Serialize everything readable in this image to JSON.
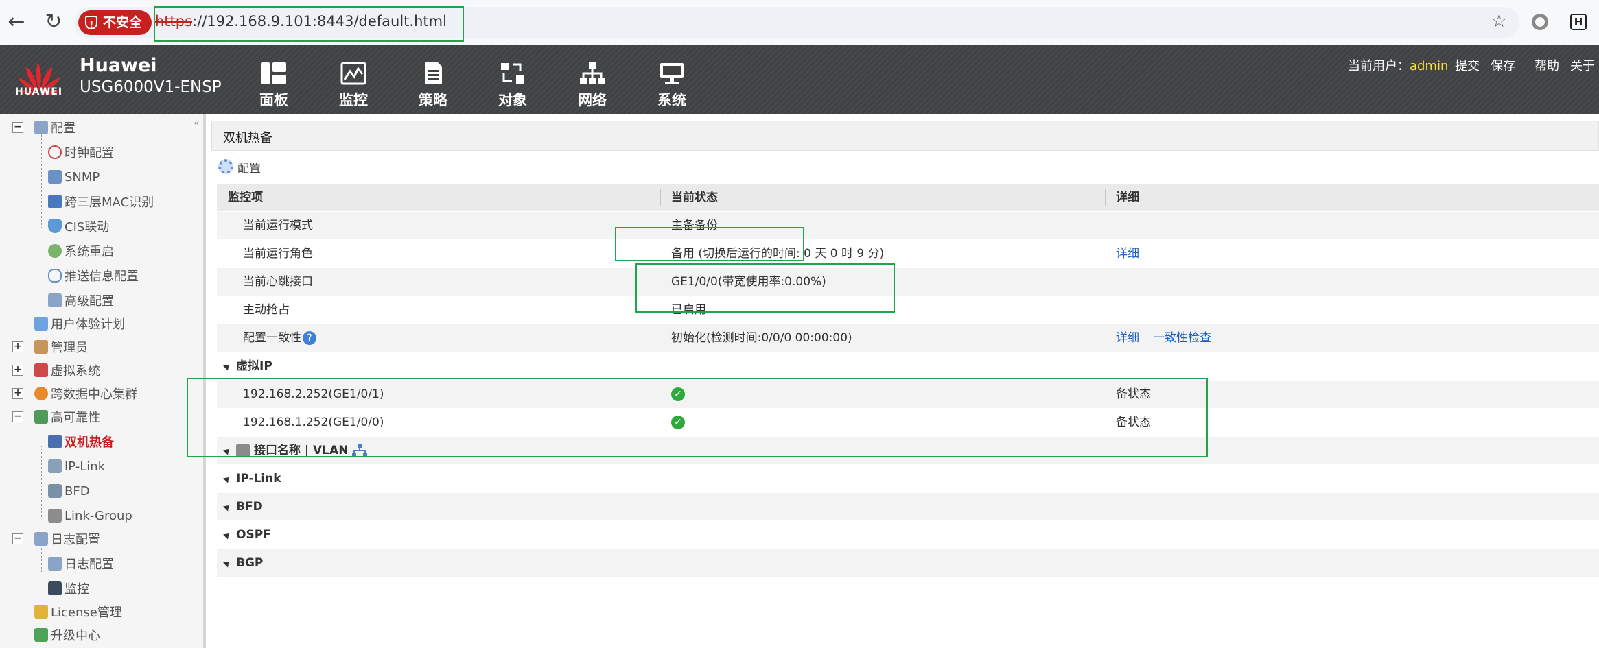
{
  "browser": {
    "insecure_label": "不安全",
    "url_scheme": "https",
    "url_rest": "://192.168.9.101:8443/default.html",
    "ext_icon_letter": "H"
  },
  "header": {
    "brand": "Huawei",
    "model": "USG6000V1-ENSP",
    "logo_text": "HUAWEI",
    "menu": [
      {
        "label": "面板",
        "icon": "dashboard-icon"
      },
      {
        "label": "监控",
        "icon": "monitor-icon"
      },
      {
        "label": "策略",
        "icon": "policy-icon"
      },
      {
        "label": "对象",
        "icon": "object-icon"
      },
      {
        "label": "网络",
        "icon": "network-icon"
      },
      {
        "label": "系统",
        "icon": "system-icon"
      }
    ],
    "user_label": "当前用户：",
    "user_name": "admin",
    "actions": [
      "提交",
      "保存",
      "帮助",
      "关于"
    ]
  },
  "sidebar": {
    "items": [
      {
        "label": "配置",
        "icon": "config-icon",
        "toggle": "−"
      },
      {
        "label": "时钟配置",
        "icon": "clock-icon"
      },
      {
        "label": "SNMP",
        "icon": "snmp-icon"
      },
      {
        "label": "跨三层MAC识别",
        "icon": "mac-icon"
      },
      {
        "label": "CIS联动",
        "icon": "cis-icon"
      },
      {
        "label": "系统重启",
        "icon": "restart-icon"
      },
      {
        "label": "推送信息配置",
        "icon": "push-icon"
      },
      {
        "label": "高级配置",
        "icon": "advanced-icon"
      },
      {
        "label": "用户体验计划",
        "icon": "ux-icon"
      },
      {
        "label": "管理员",
        "icon": "admin-icon",
        "toggle": "+"
      },
      {
        "label": "虚拟系统",
        "icon": "vsys-icon",
        "toggle": "+"
      },
      {
        "label": "跨数据中心集群",
        "icon": "cluster-icon",
        "toggle": "+"
      },
      {
        "label": "高可靠性",
        "icon": "ha-icon",
        "toggle": "−"
      },
      {
        "label": "双机热备",
        "icon": "hrp-icon"
      },
      {
        "label": "IP-Link",
        "icon": "iplink-icon"
      },
      {
        "label": "BFD",
        "icon": "bfd-icon"
      },
      {
        "label": "Link-Group",
        "icon": "linkgroup-icon"
      },
      {
        "label": "日志配置",
        "icon": "log-icon",
        "toggle": "−"
      },
      {
        "label": "日志配置",
        "icon": "log-config-icon"
      },
      {
        "label": "监控",
        "icon": "log-monitor-icon"
      },
      {
        "label": "License管理",
        "icon": "license-icon"
      },
      {
        "label": "升级中心",
        "icon": "upgrade-icon"
      }
    ]
  },
  "main": {
    "title": "双机热备",
    "config_label": "配置",
    "columns": [
      "监控项",
      "当前状态",
      "详细"
    ],
    "rows": [
      {
        "item": "当前运行模式",
        "status": "主备备份",
        "detail": ""
      },
      {
        "item": "当前运行角色",
        "status": "备用 (切换后运行的时间: 0 天 0 时 9 分)",
        "detail": "详细"
      },
      {
        "item": "当前心跳接口",
        "status": "GE1/0/0(带宽使用率:0.00%)",
        "detail": ""
      },
      {
        "item": "主动抢占",
        "status": "已启用",
        "detail": ""
      },
      {
        "item": "配置一致性",
        "status": "初始化(检测时间:0/0/0 00:00:00)",
        "detail": "详细",
        "detail2": "一致性检查"
      }
    ],
    "vip_section": "虚拟IP",
    "vips": [
      {
        "ip": "192.168.2.252(GE1/0/1)",
        "state": "备状态"
      },
      {
        "ip": "192.168.1.252(GE1/0/0)",
        "state": "备状态"
      }
    ],
    "sections": [
      "接口名称 | VLAN",
      "IP-Link",
      "BFD",
      "OSPF",
      "BGP"
    ]
  }
}
